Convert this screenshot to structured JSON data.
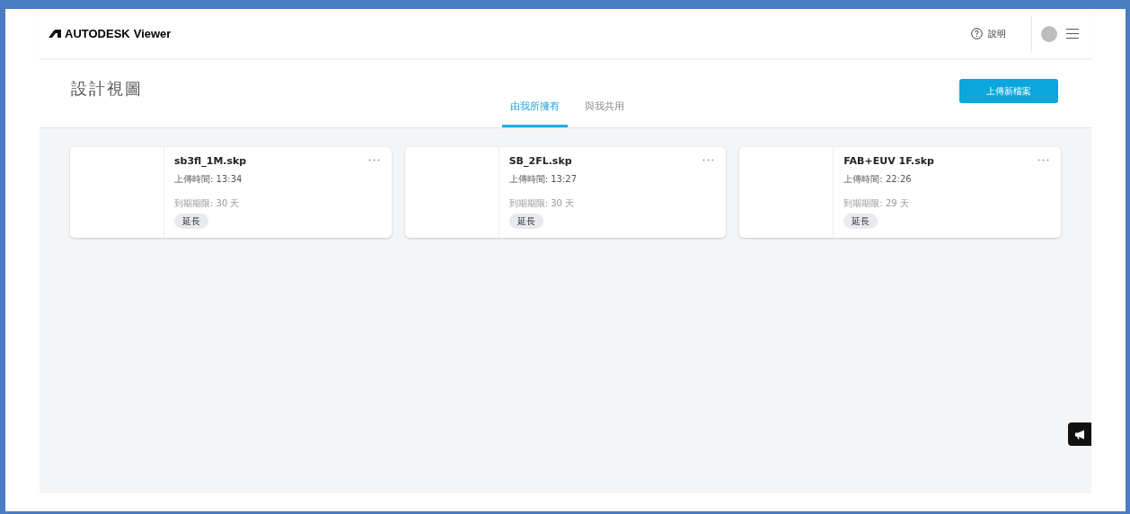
{
  "header": {
    "logo": "AUTODESK",
    "product": "Viewer",
    "help": "說明"
  },
  "page": {
    "title": "設計視圖",
    "upload_button": "上傳新檔案"
  },
  "tabs": [
    {
      "label": "由我所擁有",
      "selected": true
    },
    {
      "label": "與我共用",
      "selected": false
    }
  ],
  "files": [
    {
      "name": "sb3fl_1M.skp",
      "uploaded": "上傳時間: 13:34",
      "expiry": "到期期限: 30 天",
      "action": "延長"
    },
    {
      "name": "SB_2FL.skp",
      "uploaded": "上傳時間: 13:27",
      "expiry": "到期期限: 30 天",
      "action": "延長"
    },
    {
      "name": "FAB+EUV 1F.skp",
      "uploaded": "上傳時間: 22:26",
      "expiry": "到期期限: 29 天",
      "action": "延長"
    }
  ]
}
